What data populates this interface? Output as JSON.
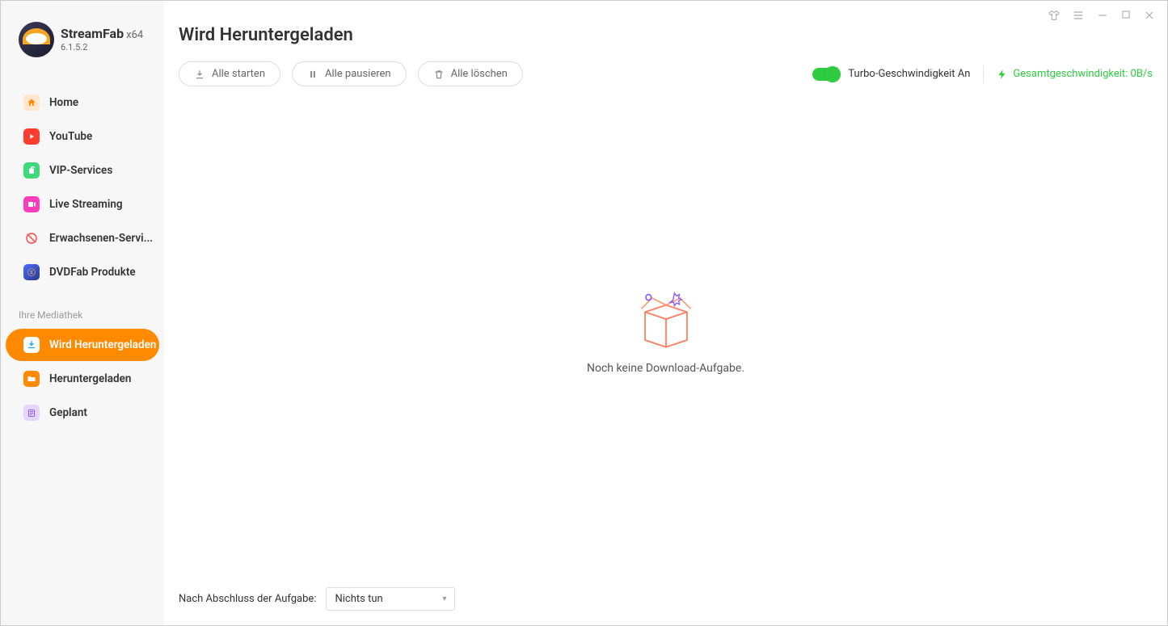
{
  "app": {
    "brand": "StreamFab",
    "arch": "x64",
    "version": "6.1.5.2"
  },
  "sidebar": {
    "items": [
      {
        "label": "Home"
      },
      {
        "label": "YouTube"
      },
      {
        "label": "VIP-Services"
      },
      {
        "label": "Live Streaming"
      },
      {
        "label": "Erwachsenen-Servi..."
      },
      {
        "label": "DVDFab Produkte"
      }
    ],
    "section_label": "Ihre Mediathek",
    "library": [
      {
        "label": "Wird Heruntergeladen"
      },
      {
        "label": "Heruntergeladen"
      },
      {
        "label": "Geplant"
      }
    ]
  },
  "page": {
    "title": "Wird Heruntergeladen"
  },
  "toolbar": {
    "start_all": "Alle starten",
    "pause_all": "Alle pausieren",
    "delete_all": "Alle löschen",
    "turbo_label": "Turbo-Geschwindigkeit An",
    "speed_label": "Gesamtgeschwindigkeit: 0B/s"
  },
  "empty": {
    "message": "Noch keine Download-Aufgabe."
  },
  "footer": {
    "label": "Nach Abschluss der Aufgabe:",
    "selected": "Nichts tun"
  }
}
